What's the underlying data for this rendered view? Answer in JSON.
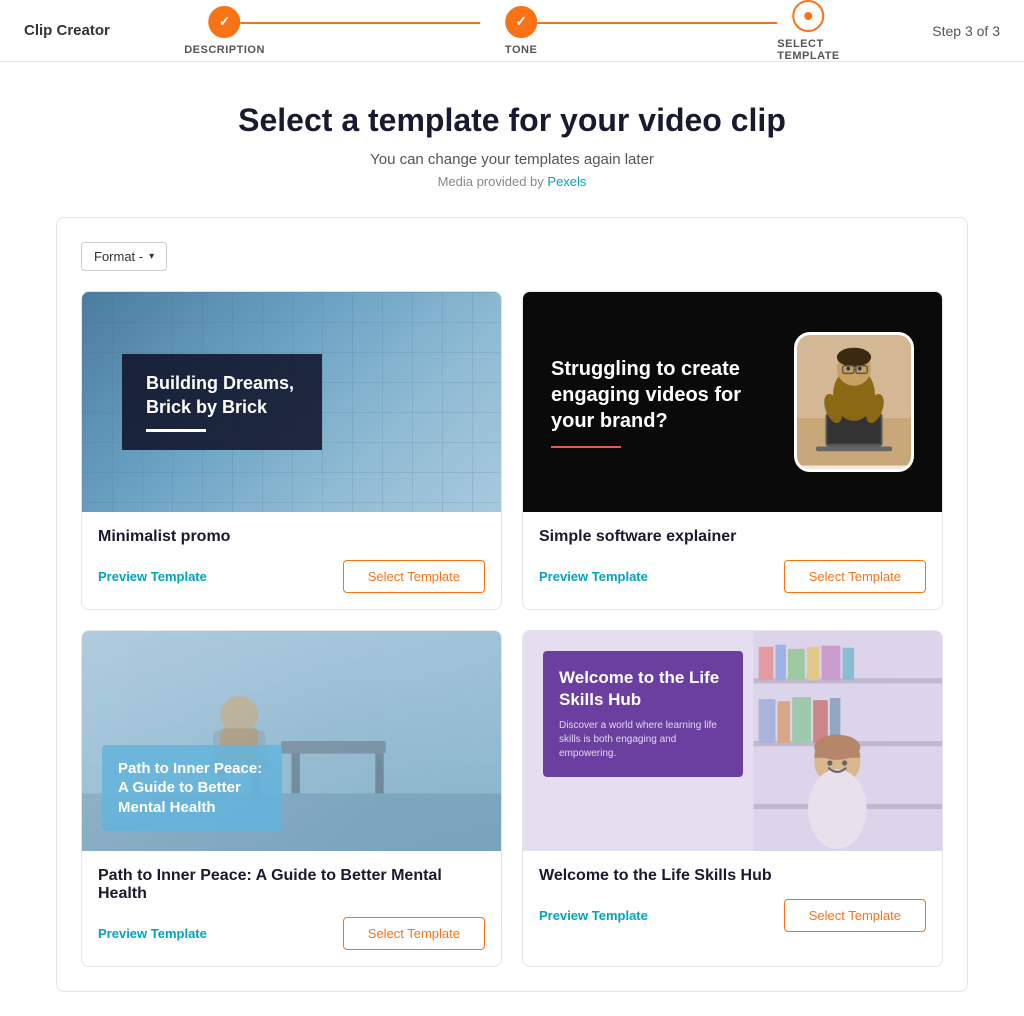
{
  "app": {
    "title": "Clip Creator"
  },
  "nav": {
    "step_label": "Step 3 of 3",
    "steps": [
      {
        "id": "description",
        "label": "DESCRIPTION",
        "state": "completed"
      },
      {
        "id": "tone",
        "label": "TONE",
        "state": "completed"
      },
      {
        "id": "select_template",
        "label": "SELECT TEMPLATE",
        "state": "active"
      }
    ]
  },
  "page": {
    "title": "Select a template for your video clip",
    "subtitle": "You can change your templates again later",
    "media_credit_text": "Media provided by ",
    "media_credit_link": "Pexels"
  },
  "format_button": {
    "label": "Format -"
  },
  "templates": [
    {
      "id": "minimalist-promo",
      "name": "Minimalist promo",
      "thumbnail_type": "minimalist",
      "title_text": "Building Dreams, Brick by Brick",
      "preview_label": "Preview Template",
      "select_label": "Select Template"
    },
    {
      "id": "simple-software-explainer",
      "name": "Simple software explainer",
      "thumbnail_type": "software",
      "title_text": "Struggling to create engaging videos for your brand?",
      "preview_label": "Preview Template",
      "select_label": "Select Template"
    },
    {
      "id": "mental-health",
      "name": "Path to Inner Peace: A Guide to Better Mental Health",
      "thumbnail_type": "mental",
      "title_text": "Path to Inner Peace: A Guide to Better Mental Health",
      "preview_label": "Preview Template",
      "select_label": "Select Template"
    },
    {
      "id": "life-skills",
      "name": "Welcome to the Life Skills Hub",
      "thumbnail_type": "skills",
      "title_text": "Welcome to the Life Skills Hub",
      "desc_text": "Discover a world where learning life skills is both engaging and empowering.",
      "preview_label": "Preview Template",
      "select_label": "Select Template"
    }
  ]
}
